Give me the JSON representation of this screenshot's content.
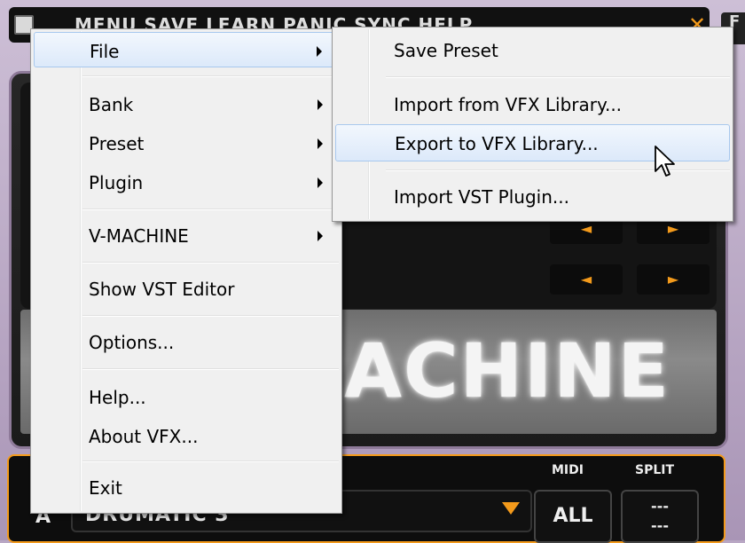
{
  "app": {
    "menubar_text": "MENU SAVE LEARN PANIC SYNC HELP",
    "close_glyph": "✕",
    "right_tab_text": "F",
    "brand_text": "ACHINE",
    "preset": {
      "slot_letter": "A",
      "name": "DRUMATIC 3"
    },
    "midi": {
      "label": "MIDI",
      "value": "ALL"
    },
    "split": {
      "label": "SPLIT",
      "value_top": "---",
      "value_bottom": "---"
    },
    "arrow_left_glyph": "◄",
    "arrow_right_glyph": "►"
  },
  "context_menu": {
    "items": [
      {
        "label": "File",
        "has_submenu": true,
        "highlighted": true
      },
      {
        "label": "Bank",
        "has_submenu": true
      },
      {
        "label": "Preset",
        "has_submenu": true
      },
      {
        "label": "Plugin",
        "has_submenu": true
      },
      {
        "label": "V-MACHINE",
        "has_submenu": true
      },
      {
        "label": "Show VST Editor",
        "has_submenu": false
      },
      {
        "label": "Options...",
        "has_submenu": false
      },
      {
        "label": "Help...",
        "has_submenu": false
      },
      {
        "label": "About VFX...",
        "has_submenu": false
      },
      {
        "label": "Exit",
        "has_submenu": false
      }
    ]
  },
  "file_submenu": {
    "items": [
      {
        "label": "Save Preset"
      },
      {
        "label": "Import from VFX Library..."
      },
      {
        "label": "Export to VFX Library...",
        "highlighted": true
      },
      {
        "label": "Import VST Plugin..."
      }
    ]
  },
  "colors": {
    "accent_orange": "#f39a1b",
    "menu_background": "#f0f0f0",
    "menu_highlight": "#dce9fa"
  },
  "icons": {
    "app_icon": "app-icon",
    "submenu_arrow": "chevron-right-icon",
    "cursor": "mouse-pointer-icon"
  }
}
